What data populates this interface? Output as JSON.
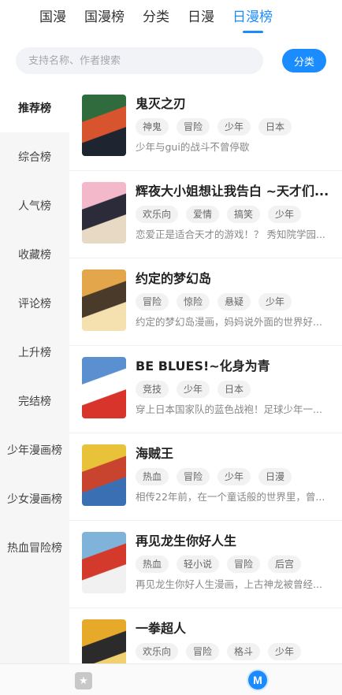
{
  "top_tabs": [
    "国漫",
    "国漫榜",
    "分类",
    "日漫",
    "日漫榜"
  ],
  "active_top_tab": 4,
  "search": {
    "placeholder": "支持名称、作者搜索",
    "button_label": "分类"
  },
  "sidebar": {
    "items": [
      "推荐榜",
      "综合榜",
      "人气榜",
      "收藏榜",
      "评论榜",
      "上升榜",
      "完结榜",
      "少年漫画榜",
      "少女漫画榜",
      "热血冒险榜"
    ],
    "active_index": 0
  },
  "comics": [
    {
      "title": "鬼灭之刃",
      "tags": [
        "神鬼",
        "冒险",
        "少年",
        "日本"
      ],
      "desc": "少年与gui的战斗不曾停歇",
      "cover_colors": [
        "#2f6b3c",
        "#d8542f",
        "#1e2530"
      ]
    },
    {
      "title": "辉夜大小姐想让我告白 ~天才们...",
      "tags": [
        "欢乐向",
        "爱情",
        "搞笑",
        "少年"
      ],
      "desc": "恋爱正是适合天才的游戏！？ 秀知院学园...",
      "cover_colors": [
        "#f3b8c9",
        "#2b2b3a",
        "#e8d9c4"
      ]
    },
    {
      "title": "约定的梦幻岛",
      "tags": [
        "冒险",
        "惊险",
        "悬疑",
        "少年"
      ],
      "desc": "约定的梦幻岛漫画，妈妈说外面的世界好...",
      "cover_colors": [
        "#e3a64a",
        "#4a3a2a",
        "#f5e0b0"
      ]
    },
    {
      "title": "BE BLUES!~化身为青",
      "tags": [
        "竞技",
        "少年",
        "日本"
      ],
      "desc": "穿上日本国家队的蓝色战袍！足球少年一...",
      "cover_colors": [
        "#5a8fd0",
        "#ffffff",
        "#d8342c"
      ]
    },
    {
      "title": "海贼王",
      "tags": [
        "热血",
        "冒险",
        "少年",
        "日漫"
      ],
      "desc": "相传22年前，在一个童话般的世界里，曾...",
      "cover_colors": [
        "#e8c33a",
        "#c9442e",
        "#3b6fb3"
      ]
    },
    {
      "title": "再见龙生你好人生",
      "tags": [
        "热血",
        "轻小说",
        "冒险",
        "后宫"
      ],
      "desc": "再见龙生你好人生漫画，上古神龙被曾经...",
      "cover_colors": [
        "#7fb3d9",
        "#d33a2c",
        "#f1f1f1"
      ]
    },
    {
      "title": "一拳超人",
      "tags": [
        "欢乐向",
        "冒险",
        "格斗",
        "少年"
      ],
      "desc": "",
      "cover_colors": [
        "#e6a92a",
        "#2b2b2b",
        "#f0d070"
      ]
    }
  ],
  "icons": {
    "favorites": "star-square-icon",
    "mine": "m-circle-icon"
  },
  "colors": {
    "accent": "#1a8cff"
  }
}
